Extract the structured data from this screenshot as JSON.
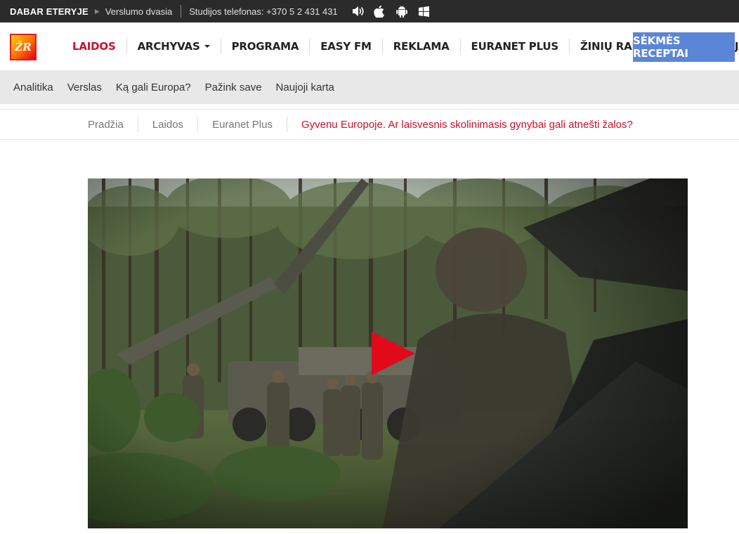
{
  "topbar": {
    "on_air_label": "DABAR ETERYJE",
    "current_show": "Verslumo dvasia",
    "studio_phone": "Studijos telefonas: +370 5 2 431 431",
    "icons": [
      "volume-icon",
      "apple-icon",
      "android-icon",
      "windows-icon"
    ]
  },
  "logo": {
    "text": "ŽR"
  },
  "mainnav": {
    "items": [
      {
        "label": "LAIDOS",
        "active": true
      },
      {
        "label": "ARCHYVAS",
        "dropdown": true
      },
      {
        "label": "PROGRAMA"
      },
      {
        "label": "EASY FM"
      },
      {
        "label": "REKLAMA"
      },
      {
        "label": "EURANET PLUS"
      },
      {
        "label": "ŽINIŲ RADIJO KONFERENCIJA"
      }
    ],
    "cta_label": "SĖKMĖS RECEPTAI"
  },
  "subnav": {
    "items": [
      "Analitika",
      "Verslas",
      "Ką gali Europa?",
      "Pažink save",
      "Naujoji karta"
    ]
  },
  "breadcrumb": {
    "items": [
      "Pradžia",
      "Laidos",
      "Euranet Plus"
    ],
    "current": "Gyvenu Europoje. Ar laisvesnis skolinimasis gynybai gali atnešti žalos?"
  },
  "video": {
    "play_icon": "play-icon"
  },
  "colors": {
    "accent_red": "#c8102e",
    "cta_blue": "#5b85d6",
    "topbar_bg": "#2b2b2b",
    "subnav_bg": "#e8e8e8"
  }
}
